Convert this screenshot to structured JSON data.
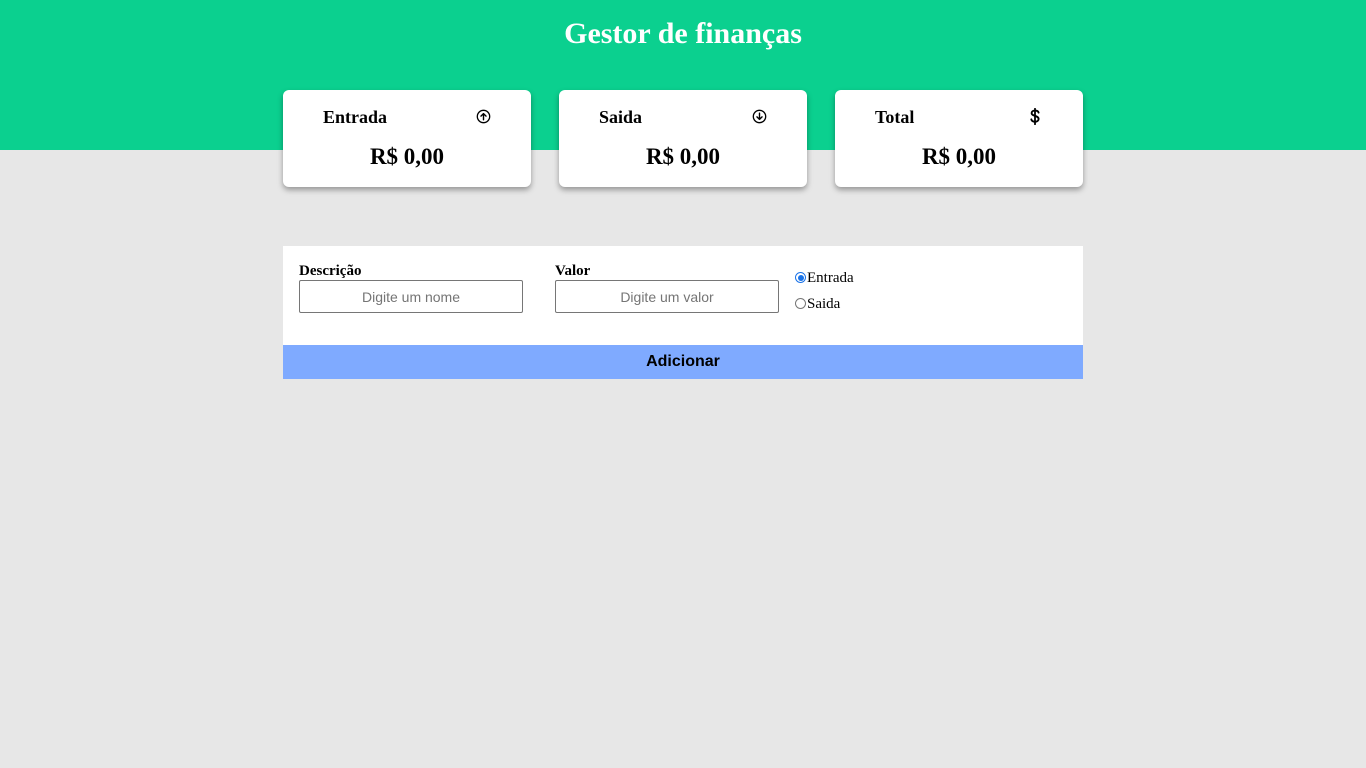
{
  "header": {
    "title": "Gestor de finanças",
    "background_color": "#0bd08f"
  },
  "cards": [
    {
      "title": "Entrada",
      "icon": "arrow-up-circle-icon",
      "value": "R$ 0,00"
    },
    {
      "title": "Saida",
      "icon": "arrow-down-circle-icon",
      "value": "R$ 0,00"
    },
    {
      "title": "Total",
      "icon": "dollar-sign-icon",
      "value": "R$ 0,00"
    }
  ],
  "form": {
    "description_label": "Descrição",
    "description_placeholder": "Digite um nome",
    "description_value": "",
    "value_label": "Valor",
    "value_placeholder": "Digite um valor",
    "value_value": "",
    "type_options": [
      {
        "label": "Entrada",
        "checked": true
      },
      {
        "label": "Saida",
        "checked": false
      }
    ],
    "submit_label": "Adicionar",
    "submit_color": "#7faaff"
  }
}
